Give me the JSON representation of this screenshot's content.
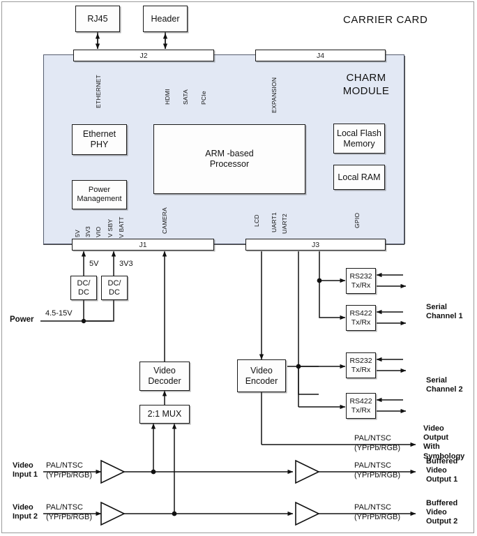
{
  "diagram": {
    "title": "CARRIER CARD",
    "module_name": "CHARM\nMODULE",
    "module_name_line1": "CHARM",
    "module_name_line2": "MODULE"
  },
  "connectors": [
    {
      "id": "J2",
      "label": "J2"
    },
    {
      "id": "J4",
      "label": "J4"
    },
    {
      "id": "J1",
      "label": "J1"
    },
    {
      "id": "J3",
      "label": "J3"
    }
  ],
  "top_blocks": [
    {
      "id": "rj45",
      "label": "RJ45"
    },
    {
      "id": "header",
      "label": "Header"
    }
  ],
  "module_blocks": [
    {
      "id": "ethernet-phy",
      "label": "Ethernet\nPHY",
      "line1": "Ethernet",
      "line2": "PHY"
    },
    {
      "id": "power-management",
      "label": "Power\nManagement",
      "line1": "Power",
      "line2": "Management"
    },
    {
      "id": "arm-processor",
      "label": "ARM -based\nProcessor",
      "line1": "ARM -based",
      "line2": "Processor"
    },
    {
      "id": "local-flash",
      "label": "Local Flash\nMemory",
      "line1": "Local Flash",
      "line2": "Memory"
    },
    {
      "id": "local-ram",
      "label": "Local RAM",
      "line1": "Local RAM",
      "line2": ""
    }
  ],
  "signal_labels": {
    "ethernet": "ETHERNET",
    "hdmi": "HDMI",
    "sata": "SATA",
    "pcie": "PCIe",
    "expansion": "EXPANSION",
    "camera": "CAMERA",
    "lcd": "LCD",
    "uart1": "UART1",
    "uart2": "UART2",
    "gpio": "GPIO"
  },
  "power_rails": [
    "5V",
    "3V3",
    "VIO",
    "V SBY",
    "V BATT"
  ],
  "power_section": {
    "input_label": "Power",
    "input_voltage": "4.5-15V",
    "dcdc_label": "DC/\nDC",
    "dcdc_line1": "DC/",
    "dcdc_line2": "DC",
    "out_5v": "5V",
    "out_3v3": "3V3"
  },
  "serial": {
    "transceivers": [
      {
        "id": "rs232-1",
        "line1": "RS232",
        "line2": "Tx/Rx"
      },
      {
        "id": "rs422-1",
        "line1": "RS422",
        "line2": "Tx/Rx"
      },
      {
        "id": "rs232-2",
        "line1": "RS232",
        "line2": "Tx/Rx"
      },
      {
        "id": "rs422-2",
        "line1": "RS422",
        "line2": "Tx/Rx"
      }
    ],
    "channel1": "Serial\nChannel 1",
    "channel1_line1": "Serial",
    "channel1_line2": "Channel 1",
    "channel2": "Serial\nChannel 2",
    "channel2_line1": "Serial",
    "channel2_line2": "Channel 2"
  },
  "video": {
    "decoder_line1": "Video",
    "decoder_line2": "Decoder",
    "encoder_line1": "Video",
    "encoder_line2": "Encoder",
    "mux": "2:1 MUX",
    "format_line1": "PAL/NTSC",
    "format_line2": "(YPrPb/RGB)",
    "input1_line1": "Video",
    "input1_line2": "Input 1",
    "input2_line1": "Video",
    "input2_line2": "Input 2",
    "output_symbology_l1": "Video",
    "output_symbology_l2": "Output",
    "output_symbology_l3": "With",
    "output_symbology_l4": "Symbology",
    "buffered1_l1": "Buffered",
    "buffered1_l2": "Video",
    "buffered1_l3": "Output 1",
    "buffered2_l1": "Buffered",
    "buffered2_l2": "Video",
    "buffered2_l3": "Output 2"
  },
  "colors": {
    "module_fill": "#e2e8f4",
    "module_border": "#555c6e",
    "line": "#111111",
    "box_fill": "#fdfdfd"
  }
}
